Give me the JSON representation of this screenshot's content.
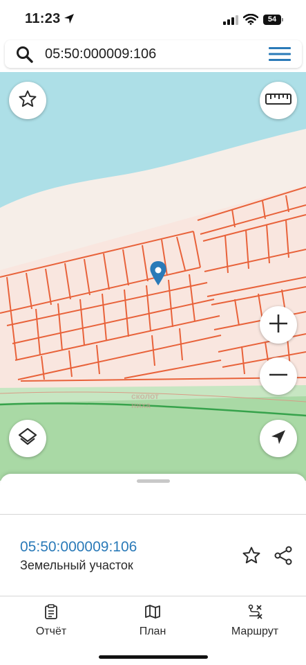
{
  "status_bar": {
    "time": "11:23",
    "battery": "54",
    "icons": [
      "location-arrow-icon",
      "signal-icon",
      "wifi-icon",
      "battery-icon"
    ]
  },
  "search": {
    "value": "05:50:000009:106",
    "icons": [
      "search-icon",
      "hamburger-menu-icon"
    ]
  },
  "map": {
    "watermark_line1": "сколот",
    "watermark_line2": "ниха",
    "controls": [
      "favorite-star-icon",
      "ruler-icon",
      "zoom-in-icon",
      "zoom-out-icon",
      "layers-icon",
      "navigation-arrow-icon"
    ],
    "colors": {
      "water": "#addfe7",
      "sand": "#f6eee8",
      "parcels": "#f9e6df",
      "parcel_border": "#e8623a",
      "green": "#a9d9a5",
      "marker": "#2a7ab8"
    }
  },
  "bottom_sheet": {
    "parcel_id": "05:50:000009:106",
    "parcel_type": "Земельный участок"
  },
  "tabs": [
    {
      "label": "Отчёт",
      "icon": "report-clipboard-icon"
    },
    {
      "label": "План",
      "icon": "map-plan-icon"
    },
    {
      "label": "Маршрут",
      "icon": "route-icon"
    }
  ]
}
